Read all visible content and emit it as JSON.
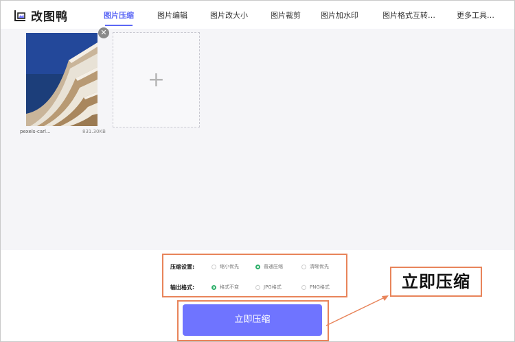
{
  "app": {
    "name": "改图鸭"
  },
  "nav": {
    "items": [
      {
        "label": "图片压缩",
        "active": true
      },
      {
        "label": "图片编辑",
        "active": false
      },
      {
        "label": "图片改大小",
        "active": false
      },
      {
        "label": "图片裁剪",
        "active": false
      },
      {
        "label": "图片加水印",
        "active": false
      },
      {
        "label": "图片格式互转…",
        "active": false
      },
      {
        "label": "更多工具…",
        "active": false
      }
    ]
  },
  "file": {
    "name": "pexels-carl...",
    "size": "831.30KB"
  },
  "upload": {
    "add_symbol": "+"
  },
  "settings": {
    "compression_label": "压缩设置:",
    "compression_options": [
      "缩小优先",
      "普通压缩",
      "清晰优先"
    ],
    "compression_selected": "普通压缩",
    "format_label": "输出格式:",
    "format_options": [
      "格式不变",
      "JPG格式",
      "PNG格式"
    ],
    "format_selected": "格式不变"
  },
  "compress_button": {
    "label": "立即压缩"
  },
  "annotation": {
    "label": "立即压缩"
  },
  "colors": {
    "accent": "#5b67f5",
    "button": "#6f74ff",
    "highlight": "#e8845a",
    "selected_radio": "#2fb06b"
  }
}
